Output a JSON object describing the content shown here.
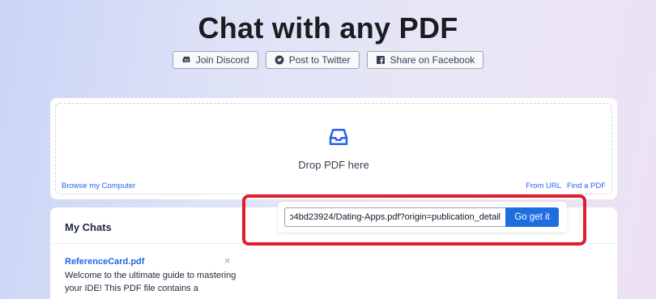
{
  "page": {
    "title": "Chat with any PDF"
  },
  "share": {
    "discord_label": "Join Discord",
    "twitter_label": "Post to Twitter",
    "facebook_label": "Share on Facebook"
  },
  "upload": {
    "drop_text": "Drop PDF here",
    "browse_label": "Browse my Computer",
    "from_url_label": "From URL",
    "find_pdf_label": "Find a PDF"
  },
  "url_popup": {
    "input_value": "o4bd23924/Dating-Apps.pdf?origin=publication_detail",
    "button_label": "Go get it"
  },
  "chats": {
    "header": "My Chats",
    "items": [
      {
        "title": "ReferenceCard.pdf",
        "close_glyph": "×",
        "description": "Welcome to the ultimate guide to mastering your IDE! This PDF file contains a"
      }
    ]
  },
  "colors": {
    "accent": "#1d6fe0",
    "link": "#2563eb",
    "highlight": "#e11d2e"
  }
}
